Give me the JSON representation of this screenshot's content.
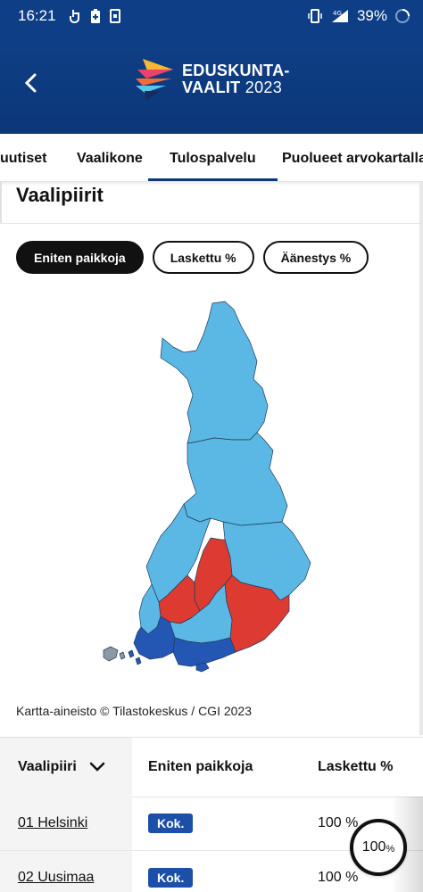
{
  "status": {
    "time": "16:21",
    "network": "4G",
    "battery": "39%"
  },
  "header": {
    "logo_line1": "EDUSKUNTA-",
    "logo_line2": "VAALIT",
    "logo_year": "2023",
    "back_icon": "chevron-left-icon"
  },
  "tabs": [
    {
      "label": "uutiset"
    },
    {
      "label": "Vaalikone"
    },
    {
      "label": "Tulospalvelu",
      "active": true
    },
    {
      "label": "Puolueet arvokartalla"
    }
  ],
  "section": {
    "title": "Vaalipiirit"
  },
  "filters": [
    {
      "label": "Eniten paikkoja",
      "active": true
    },
    {
      "label": "Laskettu %"
    },
    {
      "label": "Äänestys %"
    }
  ],
  "map": {
    "colors": {
      "light_blue": "#5bb8e4",
      "red": "#dd3b32",
      "dark_blue": "#2457b4",
      "gray": "#8c99a4"
    }
  },
  "credit": "Kartta-aineisto © Tilastokeskus / CGI 2023",
  "table": {
    "headers": {
      "district": "Vaalipiiri",
      "top_party": "Eniten paikkoja",
      "counted": "Laskettu %"
    },
    "rows": [
      {
        "district": "01 Helsinki",
        "party": "Kok.",
        "counted": "100 %"
      },
      {
        "district": "02 Uusimaa",
        "party": "Kok.",
        "counted": "100 %"
      }
    ]
  },
  "progress_widget": {
    "value": "100",
    "unit": "%"
  }
}
